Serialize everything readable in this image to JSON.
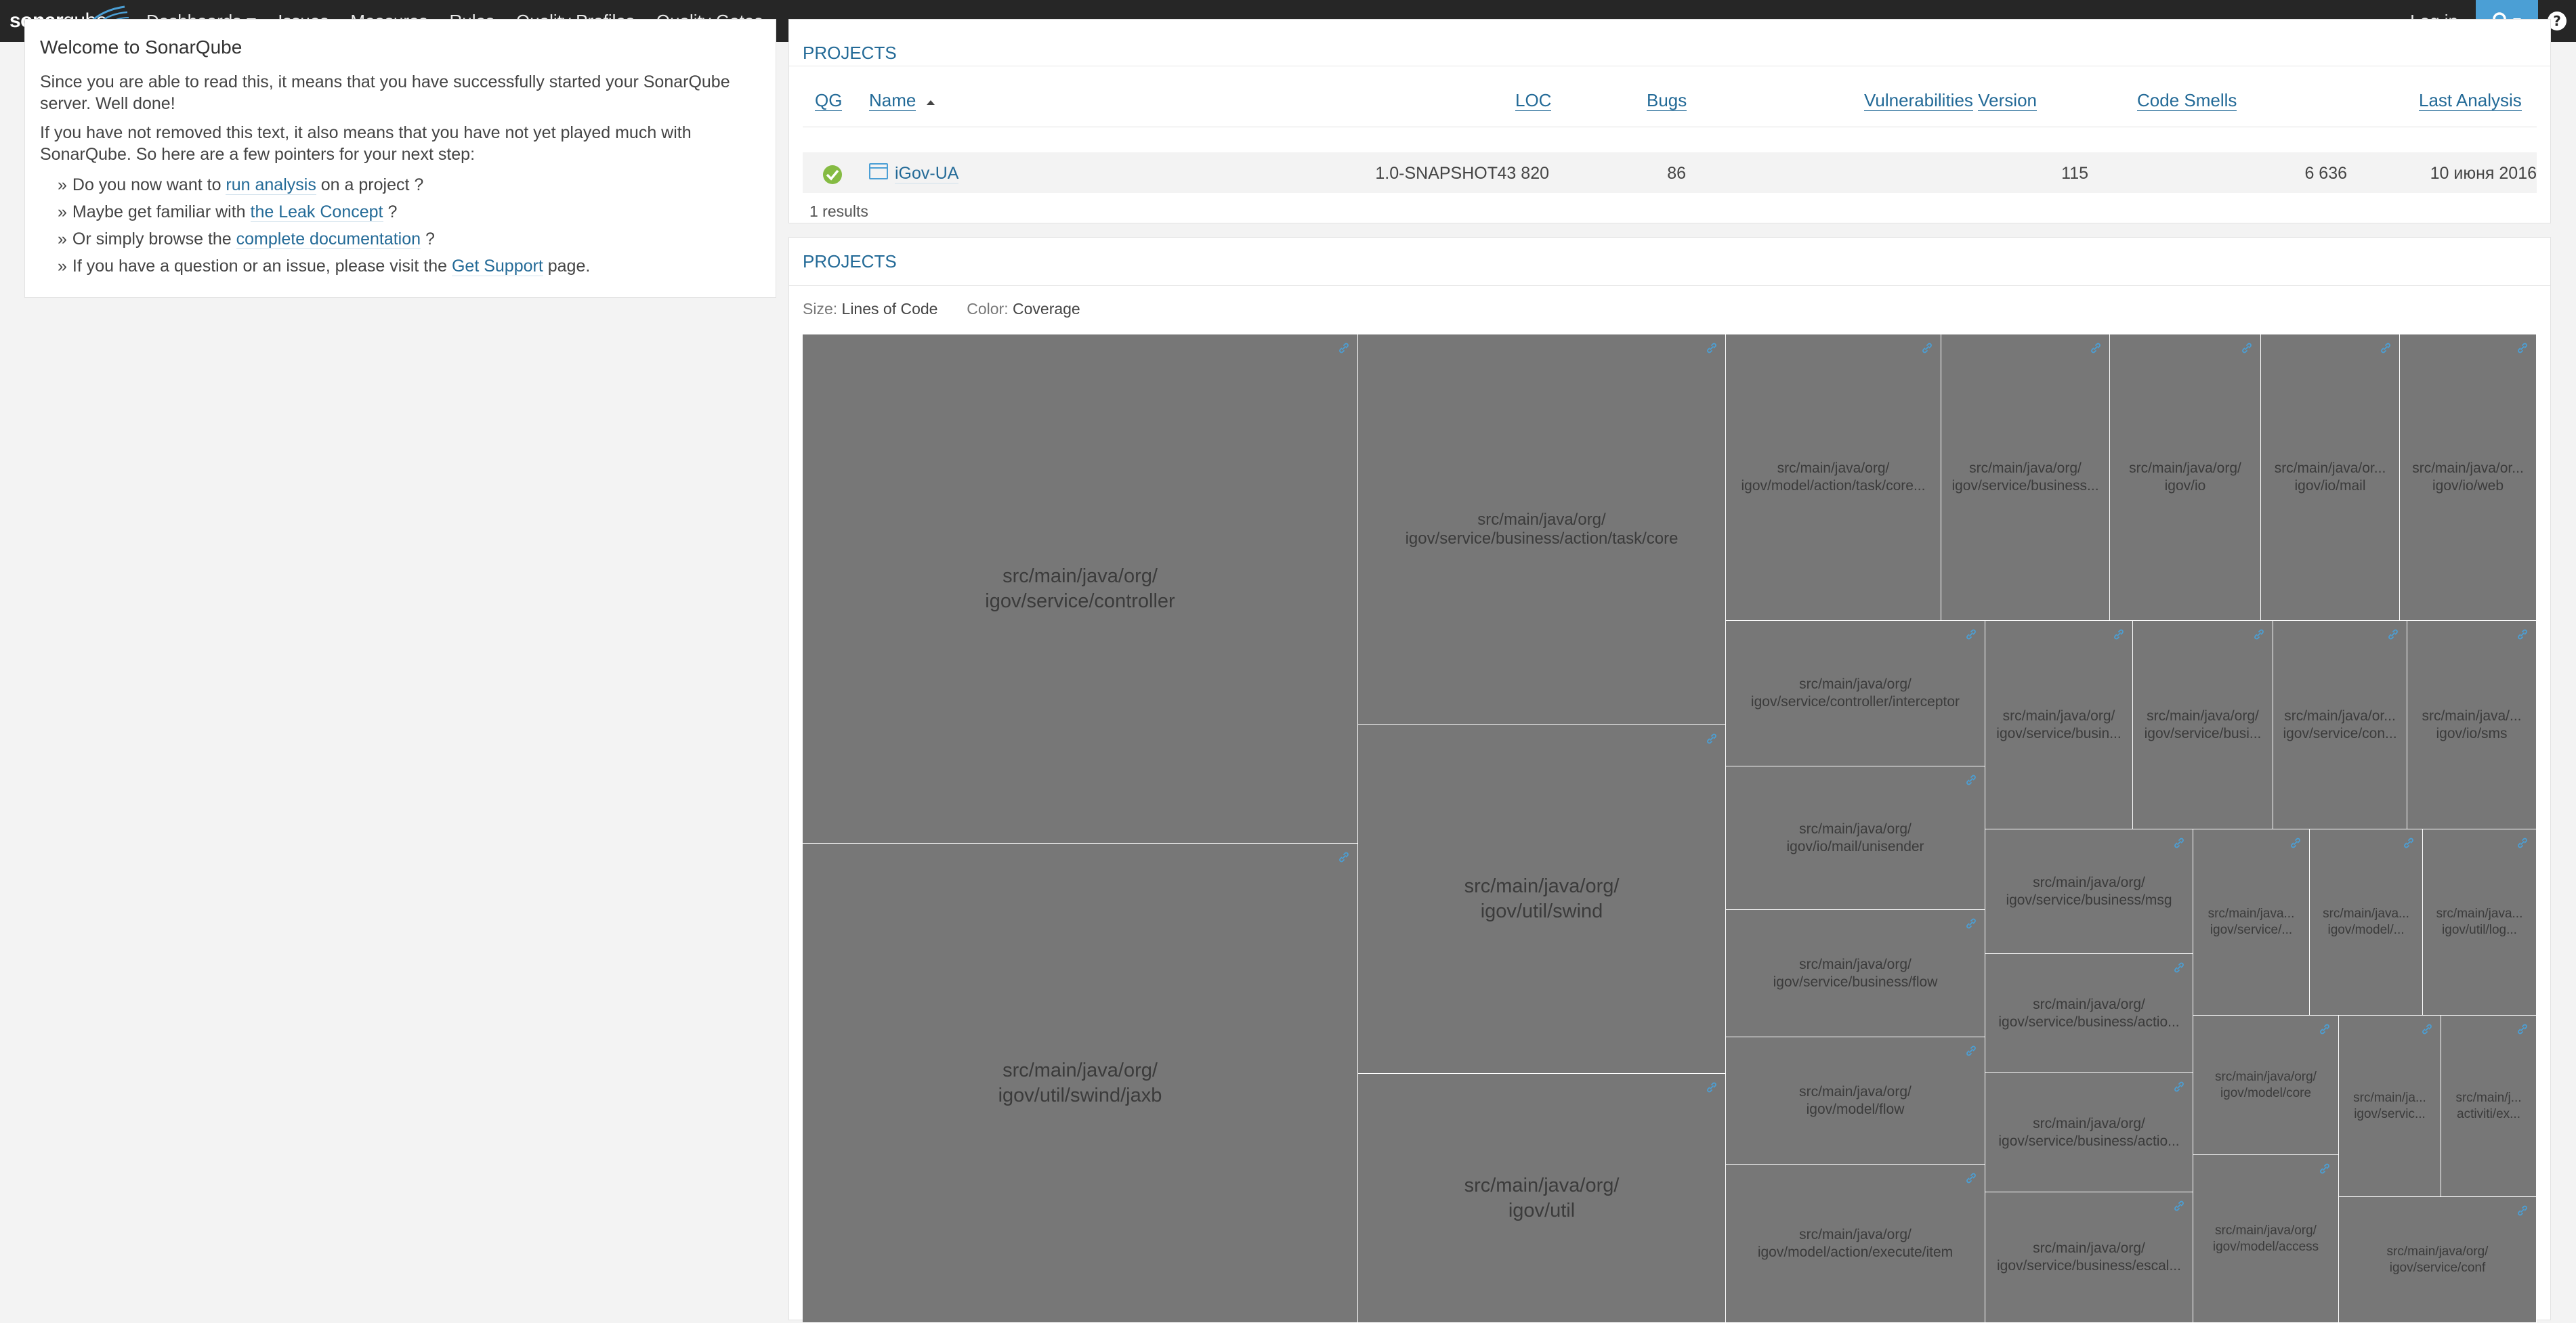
{
  "navbar": {
    "logo_brand": "sonar",
    "logo_qube": "qube",
    "items": [
      "Dashboards",
      "Issues",
      "Measures",
      "Rules",
      "Quality Profiles",
      "Quality Gates"
    ],
    "login": "Log in",
    "icons": {
      "search": "search-icon",
      "help": "help-icon"
    }
  },
  "welcome": {
    "title": "Welcome to SonarQube",
    "p1": "Since you are able to read this, it means that you have successfully started your SonarQube server. Well done!",
    "p2": "If you have not removed this text, it also means that you have not yet played much with SonarQube. So here are a few pointers for your next step:",
    "items": [
      {
        "before": "Do you now want to ",
        "link": "run analysis",
        "after": " on a project ?"
      },
      {
        "before": "Maybe get familiar with ",
        "link": "the Leak Concept",
        "after": " ?"
      },
      {
        "before": "Or simply browse the ",
        "link": "complete documentation",
        "after": " ?"
      },
      {
        "before": "If you have a question or an issue, please visit the ",
        "link": "Get Support",
        "after": " page."
      }
    ]
  },
  "projects_table": {
    "title": "PROJECTS",
    "columns": {
      "qg": "QG",
      "name": "Name",
      "version": "Version",
      "loc": "LOC",
      "bugs": "Bugs",
      "vulnerabilities": "Vulnerabilities",
      "code_smells": "Code Smells",
      "last_analysis": "Last Analysis"
    },
    "rows": [
      {
        "quality_gate": "OK",
        "name": "iGov-UA",
        "version": "1.0-SNAPSHOT",
        "loc": "43 820",
        "bugs": "86",
        "vulnerabilities": "115",
        "code_smells": "6 636",
        "last_analysis": "10 июня 2016"
      }
    ],
    "results": "1 results"
  },
  "treemap": {
    "title": "PROJECTS",
    "size_label": "Size:",
    "size_value": "Lines of Code",
    "color_label": "Color:",
    "color_value": "Coverage",
    "cell_color": "#777777",
    "cells": [
      [
        "src/main/java/org/",
        "igov/service/controller"
      ],
      [
        "src/main/java/org/",
        "igov/util/swind/jaxb"
      ],
      [
        "src/main/java/org/",
        "igov/service/business/action/task/core"
      ],
      [
        "src/main/java/org/",
        "igov/util/swind"
      ],
      [
        "src/main/java/org/",
        "igov/util"
      ],
      [
        "src/main/java/org/",
        "igov/model/action/task/core..."
      ],
      [
        "src/main/java/org/",
        "igov/service/business..."
      ],
      [
        "src/main/java/org/",
        "igov/io"
      ],
      [
        "src/main/java/or...",
        "igov/io/mail"
      ],
      [
        "src/main/java/or...",
        "igov/io/web"
      ],
      [
        "src/main/java/org/",
        "igov/service/controller/interceptor"
      ],
      [
        "src/main/java/org/",
        "igov/service/busin..."
      ],
      [
        "src/main/java/org/",
        "igov/service/busi..."
      ],
      [
        "src/main/java/or...",
        "igov/service/con..."
      ],
      [
        "src/main/java/...",
        "igov/io/sms"
      ],
      [
        "src/main/java/org/",
        "igov/io/mail/unisender"
      ],
      [
        "src/main/java/org/",
        "igov/service/business/msg"
      ],
      [
        "src/main/java...",
        "igov/service/..."
      ],
      [
        "src/main/java...",
        "igov/model/..."
      ],
      [
        "src/main/java...",
        "igov/util/log..."
      ],
      [
        "src/main/java/org/",
        "igov/service/business/flow"
      ],
      [
        "src/main/java/org/",
        "igov/service/business/actio..."
      ],
      [
        "src/main/java/org/",
        "igov/model/core"
      ],
      [
        "src/main/ja...",
        "igov/servic..."
      ],
      [
        "src/main/j...",
        "activiti/ex..."
      ],
      [
        "src/main/java/org/",
        "igov/model/flow"
      ],
      [
        "src/main/java/org/",
        "igov/service/business/actio..."
      ],
      [
        "src/main/java/org/",
        "igov/model/access"
      ],
      [
        "src/main/java/org/",
        "igov/model/action/execute/item"
      ],
      [
        "src/main/java/org/",
        "igov/service/business/escal..."
      ],
      [
        "src/main/java/org/",
        "igov/service/conf"
      ]
    ]
  }
}
